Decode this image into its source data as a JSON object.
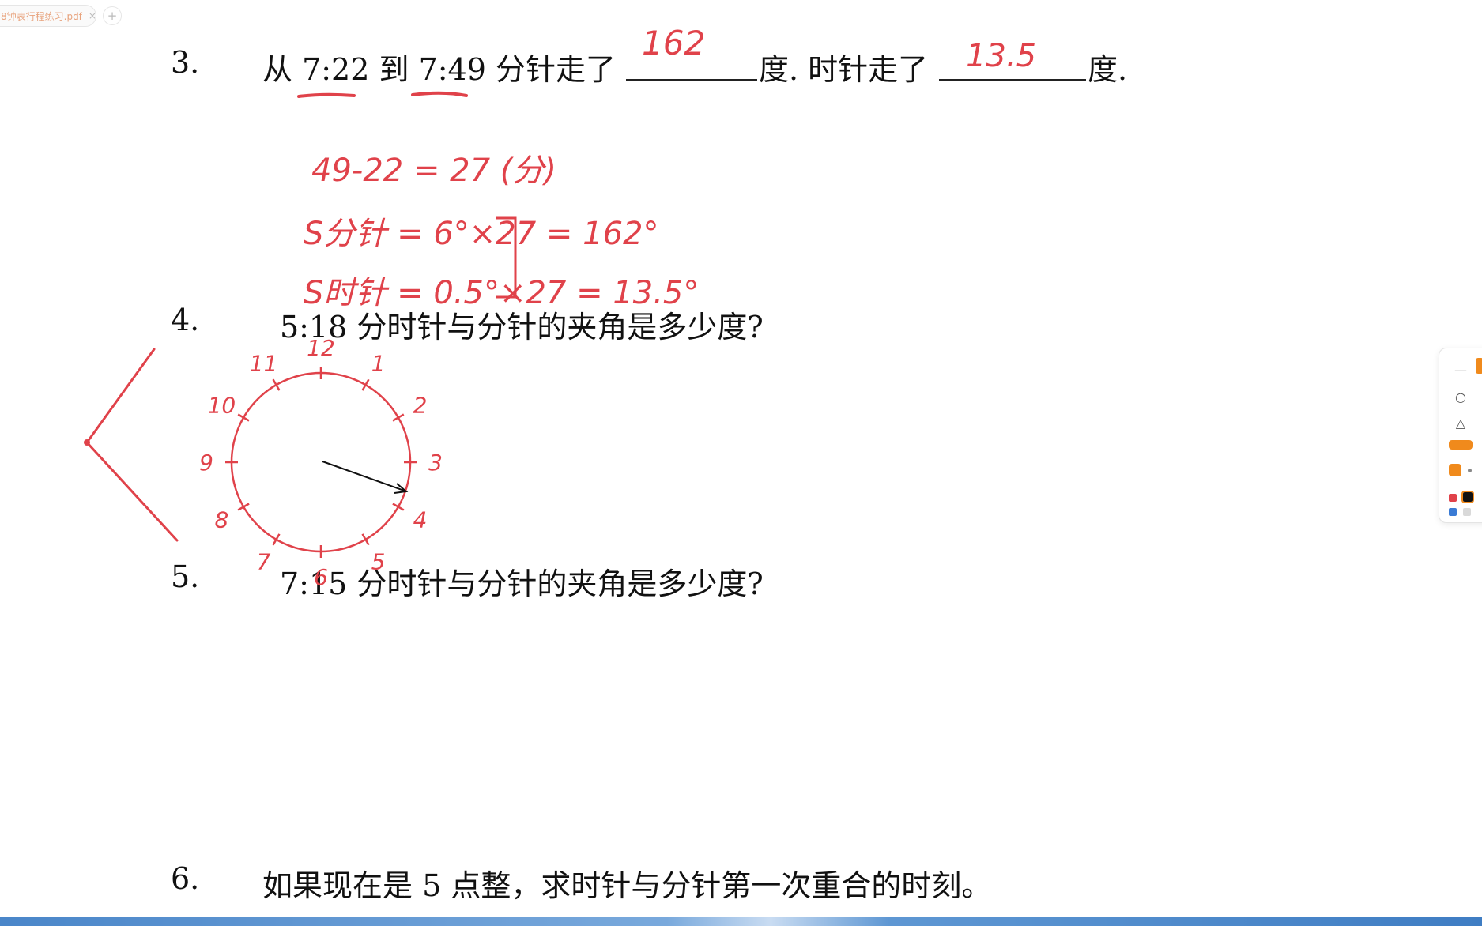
{
  "tab": {
    "label": "8钟表行程练习.pdf",
    "close": "×",
    "add": "+"
  },
  "q3": {
    "num": "3.",
    "part1": "从 7:22 到 7:49 分针走了",
    "part2": "度. 时针走了",
    "part3": "度.",
    "answer1": "162",
    "answer2": "13.5",
    "work": [
      "49-22 = 27 (分)",
      "S分针 = 6°×27 = 162°",
      "S时针 = 0.5°×27 = 13.5°"
    ]
  },
  "q4": {
    "num": "4.",
    "text": "5:18 分时针与分针的夹角是多少度?"
  },
  "q5": {
    "num": "5.",
    "text": "7:15 分时针与分针的夹角是多少度?"
  },
  "q6": {
    "num": "6.",
    "text": "如果现在是 5 点整，求时针与分针第一次重合的时刻。"
  },
  "clock": {
    "numbers": [
      "12",
      "1",
      "2",
      "3",
      "4",
      "5",
      "6",
      "7",
      "8",
      "9",
      "10",
      "11"
    ]
  },
  "colors": {
    "ink": "#e0424a",
    "accent": "#f08a1c",
    "bar": "#4a86c9"
  },
  "toolbar": {
    "line_icon": "—",
    "circle_icon": "○",
    "triangle_icon": "△"
  }
}
